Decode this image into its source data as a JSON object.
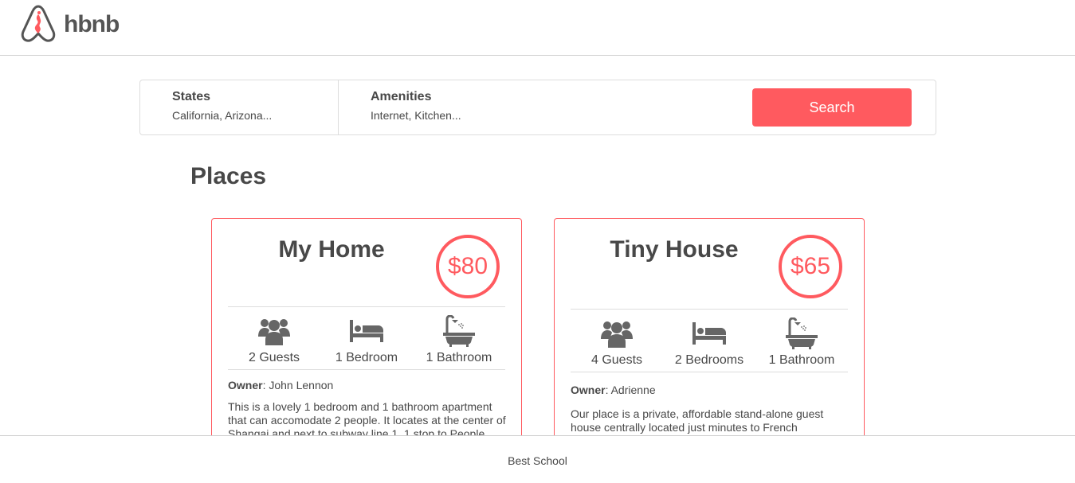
{
  "header": {
    "logo_text": "hbnb",
    "logo_icon": "airbnb-logo-icon"
  },
  "filters": {
    "states": {
      "title": "States",
      "value": "California, Arizona..."
    },
    "amenities": {
      "title": "Amenities",
      "value": "Internet, Kitchen..."
    },
    "search_label": "Search"
  },
  "places": {
    "title": "Places",
    "items": [
      {
        "name": "My Home",
        "price": "$80",
        "guests": "2 Guests",
        "bedrooms": "1 Bedroom",
        "bathrooms": "1 Bathroom",
        "owner_label": "Owner",
        "owner_name": ": John Lennon",
        "description": "This is a lovely 1 bedroom and 1 bathroom apartment that can accomodate 2 people. It locates at the center of Shangai and next to subway line 1. 1 stop to People"
      },
      {
        "name": "Tiny House",
        "price": "$65",
        "guests": "4 Guests",
        "bedrooms": "2 Bedrooms",
        "bathrooms": "1 Bathroom",
        "owner_label": "Owner",
        "owner_name": ": Adrienne",
        "description": "Our place is a private, affordable stand-alone guest house centrally located just minutes to French"
      }
    ]
  },
  "footer": {
    "text": "Best School"
  },
  "colors": {
    "accent": "#ff5a5f",
    "text": "#484848",
    "icon": "#666666",
    "border": "#dddddd"
  }
}
